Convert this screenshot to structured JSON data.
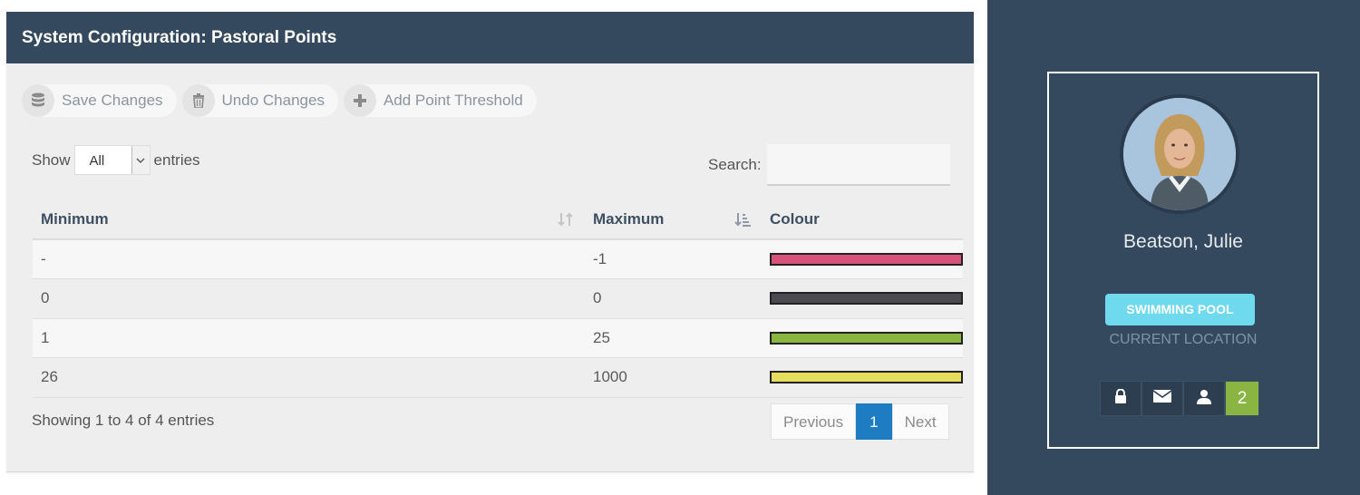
{
  "panel": {
    "title": "System Configuration: Pastoral Points"
  },
  "toolbar": {
    "save": "Save Changes",
    "undo": "Undo Changes",
    "add": "Add Point Threshold"
  },
  "table_controls": {
    "show_label": "Show",
    "entries_label": "entries",
    "page_size": "All",
    "search_label": "Search:",
    "search_value": ""
  },
  "columns": [
    "Minimum",
    "Maximum",
    "Colour"
  ],
  "rows": [
    {
      "min": "-",
      "max": "-1",
      "colour": "#d6547a"
    },
    {
      "min": "0",
      "max": "0",
      "colour": "#4a4a50"
    },
    {
      "min": "1",
      "max": "25",
      "colour": "#8ab53f"
    },
    {
      "min": "26",
      "max": "1000",
      "colour": "#e6dd5c"
    }
  ],
  "footer": {
    "info": "Showing 1 to 4 of 4 entries",
    "prev": "Previous",
    "page": "1",
    "next": "Next"
  },
  "profile": {
    "name": "Beatson, Julie",
    "location": "SWIMMING POOL",
    "location_label": "CURRENT LOCATION",
    "notification_count": "2",
    "icons": [
      "lock-icon",
      "envelope-icon",
      "user-icon"
    ]
  },
  "colors": {
    "header_bg": "#34495e",
    "accent_blue": "#1e7cc2",
    "badge": "#6fd9ee",
    "count_bg": "#8bb543"
  }
}
